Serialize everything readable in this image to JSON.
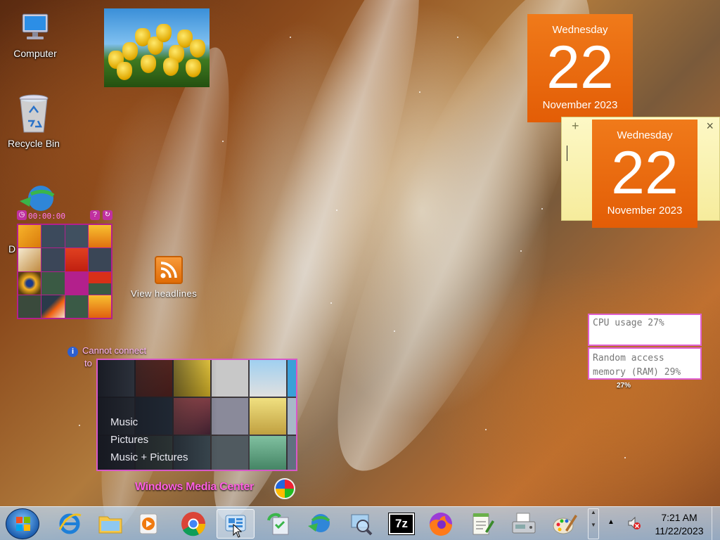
{
  "desktop": {
    "icons": [
      {
        "label": "Computer",
        "icon": "computer-icon"
      },
      {
        "label": "Recycle Bin",
        "icon": "recycle-bin-icon"
      },
      {
        "label": "D",
        "icon": "download-manager-icon"
      }
    ]
  },
  "calendar_top": {
    "weekday": "Wednesday",
    "day": "22",
    "month_year": "November 2023"
  },
  "calendar_note": {
    "weekday": "Wednesday",
    "day": "22",
    "month_year": "November 2023"
  },
  "sticky_note": {
    "add_symbol": "+",
    "close_symbol": "×"
  },
  "puzzle": {
    "timer": "00:00:00",
    "help_symbol": "?"
  },
  "feed": {
    "label": "View headlines",
    "icon": "rss-icon"
  },
  "feed_error": {
    "line1": "Cannot connect",
    "line2": "to"
  },
  "media_center": {
    "menu": [
      "Music",
      "Pictures",
      "Music + Pictures"
    ],
    "title": "Windows Media Center"
  },
  "meters": {
    "cpu": "CPU usage 27%",
    "ram_line1": "Random access",
    "ram_line2": "memory (RAM) 29%",
    "sub_value": "27%"
  },
  "taskbar": {
    "apps": [
      {
        "name": "internet-explorer-icon"
      },
      {
        "name": "file-explorer-icon"
      },
      {
        "name": "media-player-icon"
      },
      {
        "name": "chrome-icon"
      },
      {
        "name": "gadgets-icon",
        "active": true
      },
      {
        "name": "sync-icon"
      },
      {
        "name": "download-manager-icon"
      },
      {
        "name": "magnifier-icon"
      },
      {
        "name": "7zip-icon",
        "label": "7z"
      },
      {
        "name": "firefox-icon"
      },
      {
        "name": "notepad-icon"
      },
      {
        "name": "fax-icon"
      },
      {
        "name": "paint-icon"
      }
    ],
    "time": "7:21 AM",
    "date": "11/22/2023"
  }
}
